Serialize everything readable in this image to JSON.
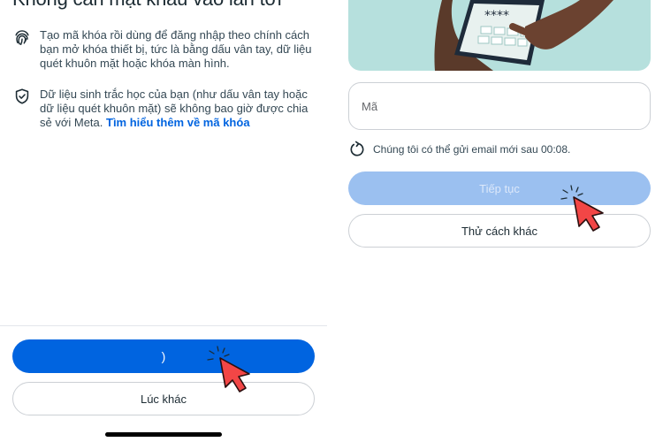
{
  "left": {
    "heading": "Không cần mật khẩu vào lần tới",
    "info1": {
      "icon": "fingerprint-icon",
      "text": "Tạo mã khóa rồi dùng để đăng nhập theo chính cách bạn mở khóa thiết bị, tức là bằng dấu vân tay, dữ liệu quét khuôn mặt hoặc khóa màn hình."
    },
    "info2": {
      "icon": "shield-check-icon",
      "text": "Dữ liệu sinh trắc học của bạn (như dấu vân tay hoặc dữ liệu quét khuôn mặt) sẽ không bao giờ được chia sẻ với Meta. ",
      "link": "Tìm hiểu thêm về mã khóa"
    },
    "primary_button": ")",
    "secondary_button": "Lúc khác"
  },
  "right": {
    "illustration": "phone-keypad-illustration",
    "code_placeholder": "Mã",
    "resend_icon": "refresh-icon",
    "resend_text": "Chúng tôi có thể gửi email mới sau 00:08.",
    "continue_button": "Tiếp tục",
    "other_button": "Thử cách khác"
  },
  "colors": {
    "primary": "#0064e0",
    "primary_disabled": "#9bc0f0",
    "illustration_bg": "#b6e0dd",
    "cursor": "#f24646"
  }
}
